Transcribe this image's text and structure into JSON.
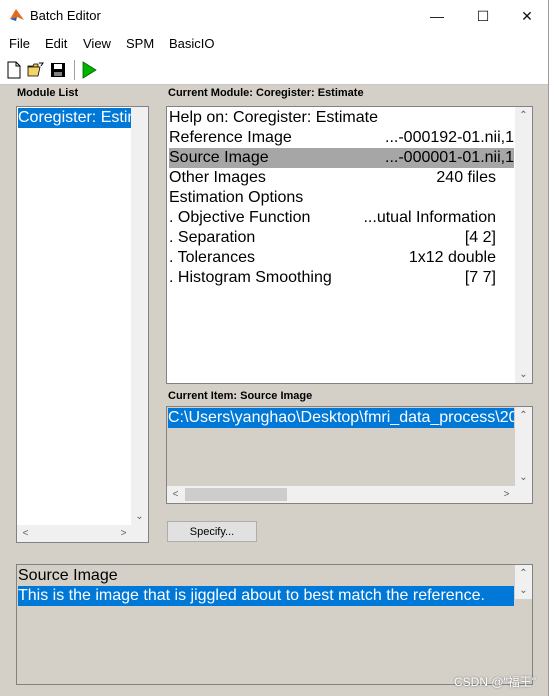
{
  "window": {
    "title": "Batch Editor",
    "minimize": "—",
    "maximize": "☐",
    "close": "✕"
  },
  "menu": [
    "File",
    "Edit",
    "View",
    "SPM",
    "BasicIO"
  ],
  "toolbar": {
    "new_icon": "new-file-icon",
    "open_icon": "open-folder-icon",
    "save_icon": "save-disk-icon",
    "run_icon": "run-play-icon"
  },
  "module_list": {
    "label": "Module List",
    "items": [
      "Coregister: Estimate"
    ]
  },
  "current_module": {
    "label": "Current Module: Coregister: Estimate",
    "rows": [
      {
        "label": "Help on: Coregister: Estimate",
        "value": ""
      },
      {
        "label": "Reference Image",
        "value": "...-000192-01.nii,1"
      },
      {
        "label": "Source Image",
        "value": "...-000001-01.nii,1"
      },
      {
        "label": "Other Images",
        "value": "240 files"
      },
      {
        "label": "Estimation Options",
        "value": ""
      },
      {
        "label": ". Objective Function",
        "value": "...utual Information"
      },
      {
        "label": ". Separation",
        "value": "[4 2]"
      },
      {
        "label": ". Tolerances",
        "value": "1x12 double"
      },
      {
        "label": ". Histogram Smoothing",
        "value": "[7 7]"
      }
    ],
    "selected_row": "Source Image"
  },
  "current_item": {
    "label": "Current Item: Source Image",
    "value": "C:\\Users\\yanghao\\Desktop\\fmri_data_process\\20"
  },
  "specify_button": "Specify...",
  "help": {
    "title": "Source Image",
    "text": "This is the image that is jiggled about to best match the reference."
  },
  "watermark": "CSDN @\"福王\"",
  "colors": {
    "selection": "#0078d7",
    "selection_inactive": "#a6a6a6",
    "panel_bg": "#d4d0c8"
  }
}
